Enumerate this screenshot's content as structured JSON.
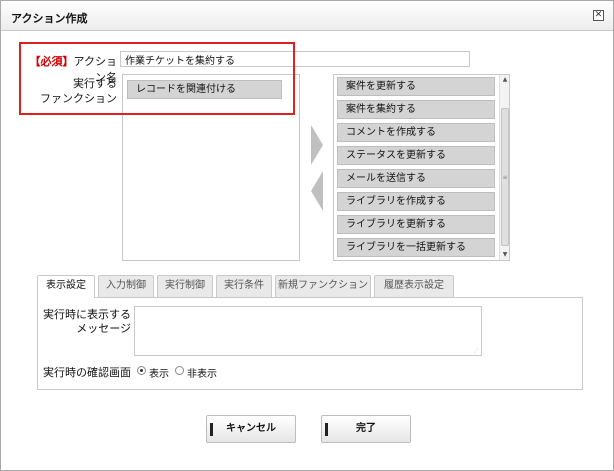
{
  "dialog": {
    "title": "アクション作成",
    "close_icon": "close-icon"
  },
  "action_name": {
    "required_tag": "【必須】",
    "label": "アクション名",
    "value": "作業チケットを集約する"
  },
  "function": {
    "label_line1": "実行する",
    "label_line2": "ファンクション",
    "selected": [
      "レコードを関連付ける"
    ],
    "available": [
      "案件を更新する",
      "案件を集約する",
      "コメントを作成する",
      "ステータスを更新する",
      "メールを送信する",
      "ライブラリを作成する",
      "ライブラリを更新する",
      "ライブラリを一括更新する"
    ],
    "add_arrow_icon": "arrow-right-icon",
    "remove_arrow_icon": "arrow-left-icon"
  },
  "tabs": [
    {
      "label": "表示設定",
      "active": true
    },
    {
      "label": "入力制御",
      "active": false
    },
    {
      "label": "実行制御",
      "active": false
    },
    {
      "label": "実行条件",
      "active": false
    },
    {
      "label": "新規ファンクション",
      "active": false
    },
    {
      "label": "履歴表示設定",
      "active": false
    }
  ],
  "display_settings": {
    "message_label_line1": "実行時に表示する",
    "message_label_line2": "メッセージ",
    "message_value": "",
    "confirm_label": "実行時の確認画面",
    "options": [
      {
        "label": "表示",
        "checked": true
      },
      {
        "label": "非表示",
        "checked": false
      }
    ]
  },
  "buttons": {
    "cancel": "キャンセル",
    "done": "完了"
  }
}
